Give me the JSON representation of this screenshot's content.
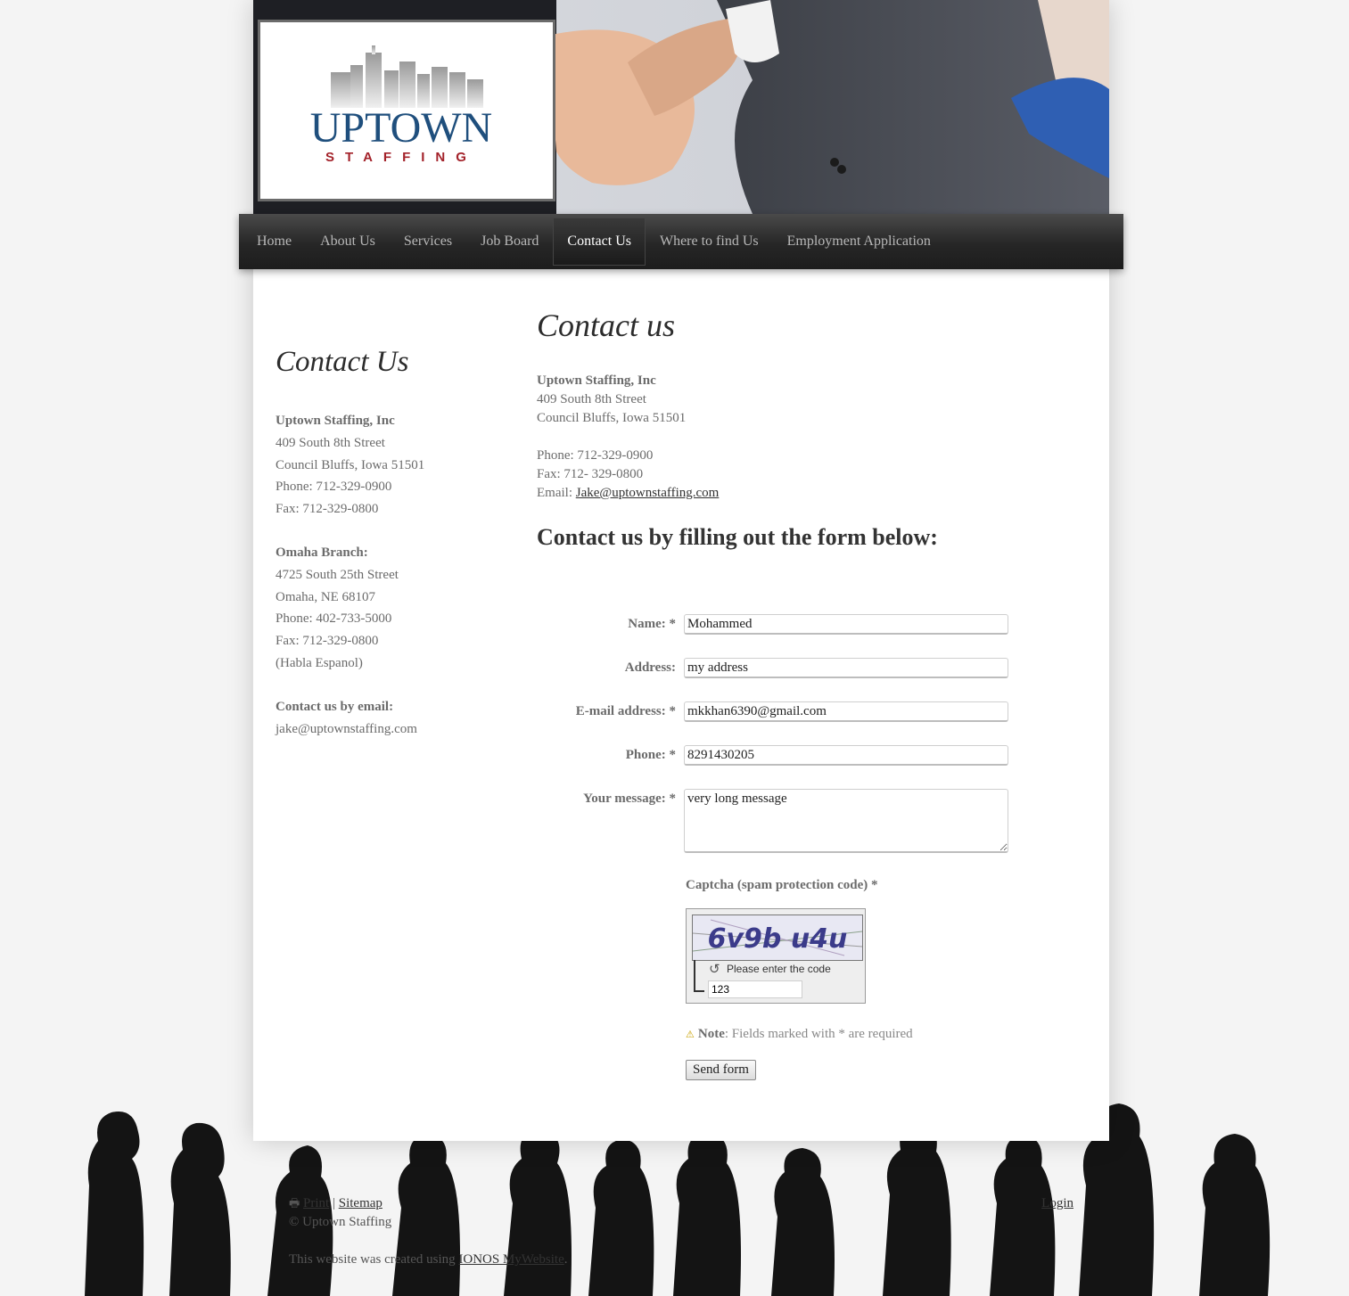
{
  "logo": {
    "text_main": "UPTOWN",
    "text_sub": "STAFFING"
  },
  "nav": {
    "items": [
      {
        "label": "Home"
      },
      {
        "label": "About Us"
      },
      {
        "label": "Services"
      },
      {
        "label": "Job Board"
      },
      {
        "label": "Contact Us"
      },
      {
        "label": "Where to find Us"
      },
      {
        "label": "Employment Application"
      }
    ],
    "active": "Contact Us"
  },
  "sidebar": {
    "title": "Contact Us",
    "company": "Uptown Staffing, Inc",
    "street": "409 South 8th Street",
    "city": "Council Bluffs, Iowa 51501",
    "phone": "Phone: 712-329-0900",
    "fax": "Fax: 712-329-0800",
    "omaha_title": "Omaha Branch:",
    "omaha_street": "4725 South 25th Street",
    "omaha_city": "Omaha, NE 68107",
    "omaha_phone": "Phone: 402-733-5000",
    "omaha_fax": "Fax: 712-329-0800",
    "omaha_note": "(Habla Espanol)",
    "email_title": "Contact us by email:",
    "email": "jake@uptownstaffing.com"
  },
  "main": {
    "title": "Contact us",
    "company": "Uptown Staffing, Inc",
    "street": "409 South 8th Street",
    "city": "Council Bluffs, Iowa 51501",
    "phone": "Phone: 712-329-0900",
    "fax": "Fax: 712- 329-0800",
    "email_label": "Email: ",
    "email_link": "Jake@uptownstaffing.com",
    "form_heading": "Contact us by filling out the form below:"
  },
  "form": {
    "name_label": "Name: *",
    "name_value": "Mohammed",
    "address_label": "Address:",
    "address_value": "my address",
    "email_label": "E-mail address: *",
    "email_value": "mkkhan6390@gmail.com",
    "phone_label": "Phone: *",
    "phone_value": "8291430205",
    "message_label": "Your message: *",
    "message_value": "very long message",
    "captcha_label": "Captcha (spam protection code) *",
    "captcha_code": "6v9b u4u",
    "captcha_hint": "Please enter the code",
    "captcha_value": "123",
    "note_bold": "Note",
    "note_text": ": Fields marked with * are required",
    "submit_label": "Send form"
  },
  "footer": {
    "print": "Print",
    "separator": "|",
    "sitemap": "Sitemap",
    "copyright": "© Uptown Staffing",
    "login": "Login",
    "created_prefix": "This website was created using ",
    "created_link": "IONOS MyWebsite",
    "created_suffix": "."
  },
  "colors": {
    "nav_bg": "#262626",
    "logo_blue": "#1f4f7d",
    "logo_red": "#a3222a",
    "text_gray": "#6b6b6b",
    "heading_dark": "#2c2c2c"
  }
}
